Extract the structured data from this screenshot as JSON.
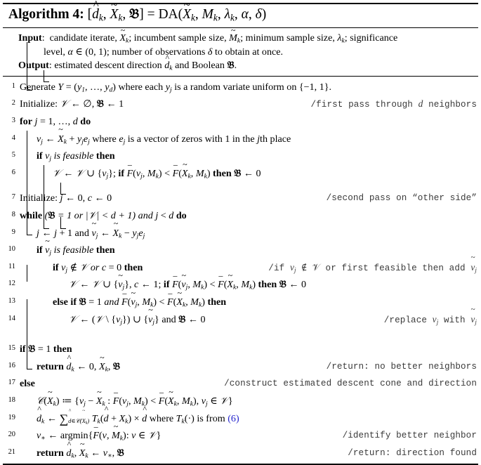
{
  "algorithm": {
    "keyword": "Algorithm",
    "number": "4",
    "signature": "[d̂ₖ, X̃ₖ, 𝔅] = DA(X̃ₖ, Mₖ, λₖ, α, δ)",
    "title_full": "Algorithm 4: [d̂_k, X̃_k, 𝔅] = DA(X̃_k, M_k, λ_k, α, δ)"
  },
  "io": {
    "input_label": "Input",
    "input_line1": "candidate iterate, X̃_k; incumbent sample size, M̃_k; minimum sample size, λ_k; significance",
    "input_line2": "level, α ∈ (0, 1); number of observations δ to obtain at once.",
    "output_label": "Output",
    "output_line": "estimated descent direction d̂_k and Boolean 𝔅."
  },
  "lines": [
    {
      "n": "1",
      "indent": 0,
      "text": "Generate Y = (y_1, …, y_d) where each y_j is a random variate uniform on {−1, 1}.",
      "comment": ""
    },
    {
      "n": "2",
      "indent": 0,
      "text": "Initialize: 𝒱 ← ∅, 𝔅 ← 1",
      "comment": "/first pass through d neighbors"
    },
    {
      "n": "3",
      "indent": 0,
      "text": "for j = 1, …, d do",
      "comment": ""
    },
    {
      "n": "4",
      "indent": 1,
      "text": "v_j ← X̃_k + y_j e_j where e_j is a vector of zeros with 1 in the jth place",
      "comment": ""
    },
    {
      "n": "5",
      "indent": 1,
      "text": "if v_j is feasible then",
      "comment": ""
    },
    {
      "n": "6",
      "indent": 2,
      "text": "𝒱 ← 𝒱 ∪ {v_j}; if F̄(v_j, M_k) < F̄(X̃_k, M_k) then 𝔅 ← 0",
      "comment": ""
    },
    {
      "n": "7",
      "indent": 0,
      "text": "Initialize: j ← 0, c ← 0",
      "comment": "/second pass on “other side”"
    },
    {
      "n": "8",
      "indent": 0,
      "text": "while (𝔅 = 1 or |𝒱| < d + 1) and j < d do",
      "comment": ""
    },
    {
      "n": "9",
      "indent": 1,
      "text": "j ← j + 1 and ṽ_j ← X̃_k − y_j e_j",
      "comment": ""
    },
    {
      "n": "10",
      "indent": 1,
      "text": "if ṽ_j is feasible then",
      "comment": ""
    },
    {
      "n": "11",
      "indent": 2,
      "text": "if v_j ∉ 𝒱 or c = 0 then",
      "comment": "/if v_j ∉ 𝒱 or first feasible then add ṽ_j"
    },
    {
      "n": "12",
      "indent": 3,
      "text": "𝒱 ← 𝒱 ∪ {ṽ_j}, c ← 1; if F̄(ṽ_j, M_k) < F̄(X̃_k, M_k) then 𝔅 ← 0",
      "comment": ""
    },
    {
      "n": "13",
      "indent": 2,
      "text": "else if 𝔅 = 1 and F̄(ṽ_j, M_k) < F̄(X̃_k, M_k) then",
      "comment": ""
    },
    {
      "n": "14",
      "indent": 3,
      "text": "𝒱 ← (𝒱 \\ {v_j}) ∪ {ṽ_j} and 𝔅 ← 0",
      "comment": "/replace v_j with ṽ_j"
    },
    {
      "n": "15",
      "indent": 0,
      "text": "if 𝔅 = 1 then",
      "comment": ""
    },
    {
      "n": "16",
      "indent": 1,
      "text": "return d̂_k ← 0, X̃_k, 𝔅",
      "comment": "/return: no better neighbors"
    },
    {
      "n": "17",
      "indent": 0,
      "text": "else",
      "comment": "/construct estimated descent cone and direction"
    },
    {
      "n": "18",
      "indent": 1,
      "text": "𝒞(X̃_k) ≔ {v_j − X̃_k : F̄(v_j, M_k) < F̄(X̃_k, M_k), v_j ∈ 𝒱}",
      "comment": ""
    },
    {
      "n": "19",
      "indent": 1,
      "text": "d̂_k ← ∑_{d̂∈𝒞(X̃_k)} T_k(d̂ + X_k) × d̂ where T_k(·) is from (6)",
      "comment": ""
    },
    {
      "n": "20",
      "indent": 1,
      "text": "v_* ← argmin{F̄(v, M̃_k) : v ∈ 𝒱}",
      "comment": "/identify better neighbor"
    },
    {
      "n": "21",
      "indent": 1,
      "text": "return d̂_k, X̃_k ← v_*, 𝔅",
      "comment": "/return: direction found"
    }
  ],
  "comments": {
    "c2": "/first pass through d neighbors",
    "c7": "/second pass on “other side”",
    "c11_a": "/if v",
    "c11_b": " ∉ 𝒱 or first feasible then add ",
    "c14": "/replace v_j with ṽ_j",
    "c16": "/return: no better neighbors",
    "c17": "/construct estimated descent cone and direction",
    "c20": "/identify better neighbor",
    "c21": "/return: direction found"
  },
  "colors": {
    "text": "#000000",
    "comment": "#3a3a3a",
    "reference_link": "#2222cc",
    "background": "#ffffff"
  },
  "reference": {
    "equation_number": "(6)",
    "label": "6"
  }
}
